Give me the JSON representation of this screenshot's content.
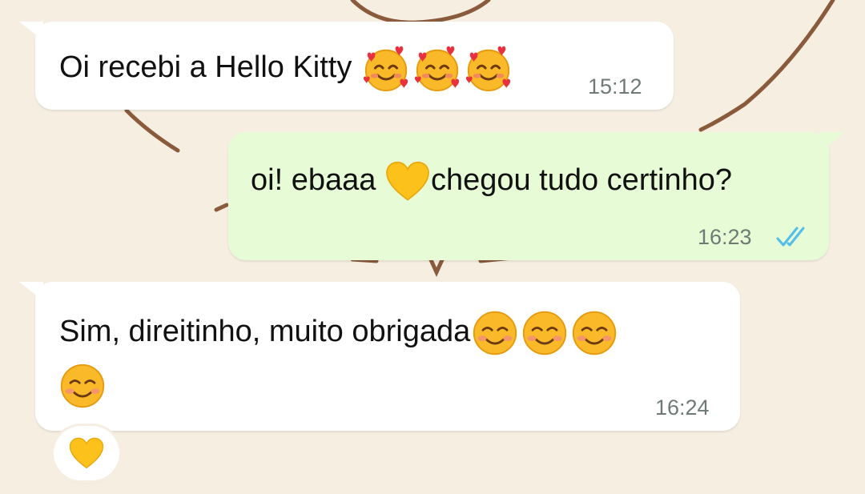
{
  "chat": {
    "messages": [
      {
        "direction": "incoming",
        "text": "Oi recebi a Hello Kitty",
        "emojis": [
          "smiling-face-with-hearts",
          "smiling-face-with-hearts",
          "smiling-face-with-hearts"
        ],
        "time": "15:12"
      },
      {
        "direction": "outgoing",
        "text_before": "oi! ebaaa",
        "emoji": "yellow-heart",
        "text_after": "chegou tudo certinho?",
        "time": "16:23",
        "status": "read"
      },
      {
        "direction": "incoming",
        "text": "Sim, direitinho, muito obrigada",
        "emojis": [
          "smiling-face-with-smiling-eyes",
          "smiling-face-with-smiling-eyes",
          "smiling-face-with-smiling-eyes",
          "smiling-face-with-smiling-eyes"
        ],
        "time": "16:24",
        "reaction": "yellow-heart"
      }
    ]
  },
  "colors": {
    "background": "#f5eee1",
    "incoming_bubble": "#ffffff",
    "outgoing_bubble": "#e7fcd6",
    "read_ticks": "#53bdeb",
    "timestamp": "#6f7a75"
  }
}
